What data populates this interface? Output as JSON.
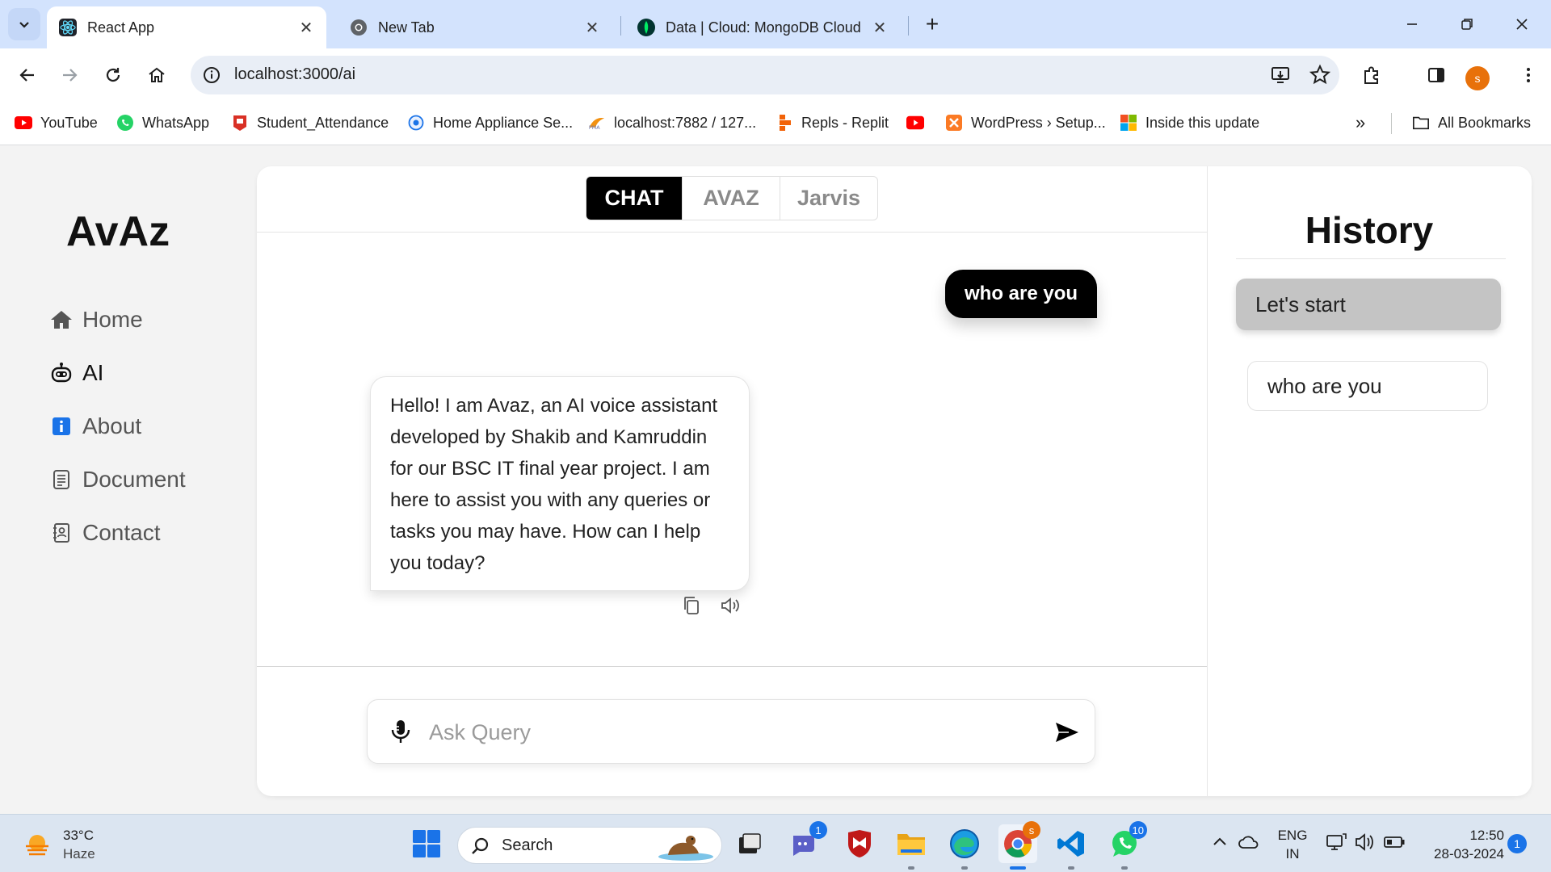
{
  "browser": {
    "tabs": [
      {
        "title": "React App",
        "active": true
      },
      {
        "title": "New Tab",
        "active": false
      },
      {
        "title": "Data | Cloud: MongoDB Cloud",
        "active": false
      }
    ],
    "url": "localhost:3000/ai",
    "profile_initial": "s",
    "bookmarks": [
      {
        "label": "YouTube",
        "icon": "youtube-icon"
      },
      {
        "label": "WhatsApp",
        "icon": "whatsapp-icon"
      },
      {
        "label": "Student_Attendance",
        "icon": "attendance-icon"
      },
      {
        "label": "Home Appliance Se...",
        "icon": "globe-icon"
      },
      {
        "label": "localhost:7882 / 127...",
        "icon": "phpmyadmin-icon"
      },
      {
        "label": "Repls - Replit",
        "icon": "replit-icon"
      },
      {
        "label": "",
        "icon": "youtube-icon"
      },
      {
        "label": "WordPress › Setup...",
        "icon": "xampp-icon"
      },
      {
        "label": "Inside this update",
        "icon": "windows-icon"
      }
    ],
    "all_bookmarks_label": "All Bookmarks"
  },
  "app": {
    "logo": "AvAz",
    "nav": [
      {
        "label": "Home",
        "icon": "home-icon",
        "active": false
      },
      {
        "label": "AI",
        "icon": "robot-icon",
        "active": true
      },
      {
        "label": "About",
        "icon": "info-icon",
        "active": false
      },
      {
        "label": "Document",
        "icon": "document-icon",
        "active": false
      },
      {
        "label": "Contact",
        "icon": "contact-book-icon",
        "active": false
      }
    ],
    "modes": [
      "CHAT",
      "AVAZ",
      "Jarvis"
    ],
    "active_mode": "CHAT",
    "messages": {
      "user": "who are you",
      "bot": "Hello! I am Avaz, an AI voice assistant developed by Shakib and Kamruddin for our BSC IT final year project. I am here to assist you with any queries or tasks you may have. How can I help you today?"
    },
    "query_placeholder": "Ask Query",
    "history": {
      "title": "History",
      "items": [
        "Let's start",
        "who are you"
      ]
    }
  },
  "taskbar": {
    "weather_temp": "33°C",
    "weather_desc": "Haze",
    "search_label": "Search",
    "teams_badge": "1",
    "whatsapp_badge": "10",
    "language": "ENG",
    "region": "IN",
    "time": "12:50",
    "date": "28-03-2024",
    "notification_count": "1"
  },
  "colors": {
    "tabstrip": "#d3e3fd",
    "accent": "#000000",
    "history_selected": "#c4c4c4",
    "taskbar": "#dbe5f1"
  }
}
